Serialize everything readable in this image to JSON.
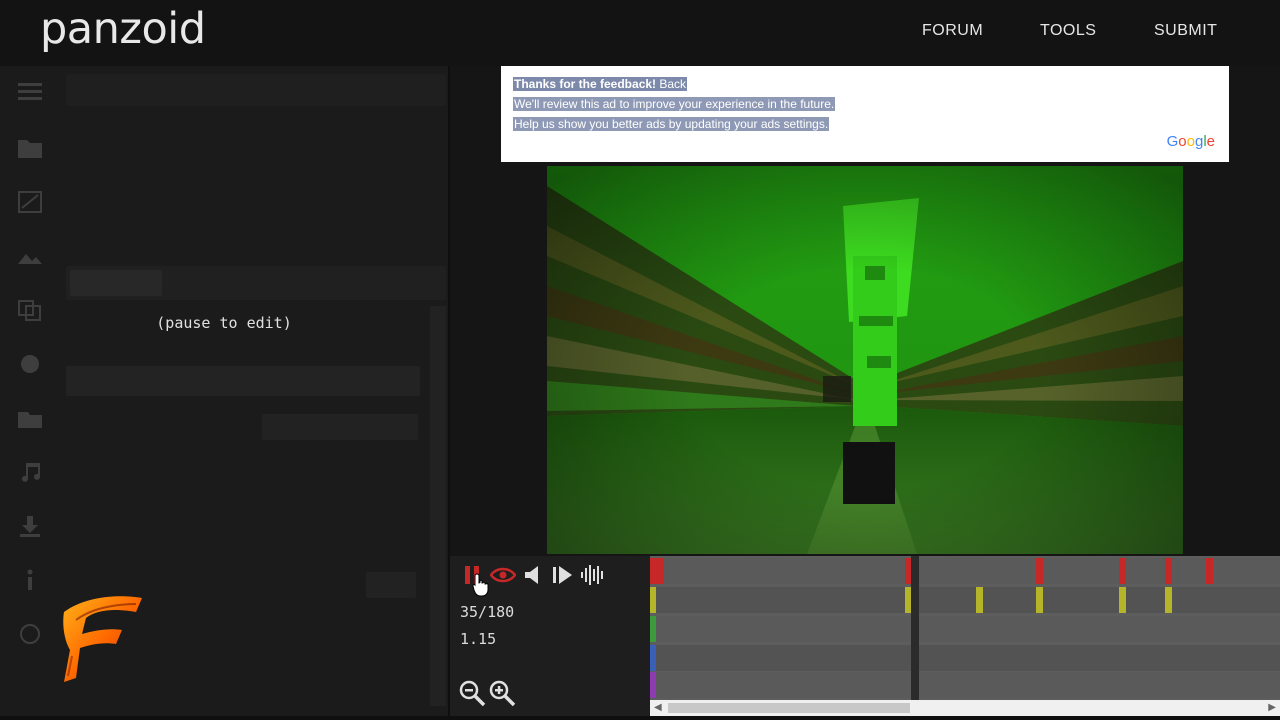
{
  "brand": {
    "logo_text": "panzoid"
  },
  "nav": {
    "items": [
      "FORUM",
      "TOOLS",
      "SUBMIT"
    ]
  },
  "editor": {
    "pause_message": "(pause to edit)",
    "rail_icons": [
      "menu-icon",
      "folder-icon",
      "crop-icon",
      "image-icon",
      "layers-icon",
      "shape-icon",
      "folder-2-icon",
      "music-icon",
      "download-icon",
      "info-icon",
      "circle-icon"
    ]
  },
  "ad": {
    "line1_bold": "Thanks for the feedback!",
    "line1_link": "Back",
    "line2": "We'll review this ad to improve your experience in the future.",
    "line3": "Help us show you better ads by updating your ads settings.",
    "google_label": "Google"
  },
  "playback": {
    "frame": "35/180",
    "time": "1.15",
    "progress": 0.194
  },
  "timeline": {
    "track_colors": [
      "#c62828",
      "#b5b52a",
      "#3c9b3c",
      "#3a5fb8",
      "#8e3ab0"
    ],
    "markers_row1": [
      0.0,
      0.405,
      0.613,
      0.745,
      0.817,
      0.883
    ],
    "markers_row2": [
      0.0,
      0.405,
      0.517,
      0.613,
      0.745,
      0.817
    ],
    "playhead": 0.414
  },
  "colors": {
    "accent_red": "#c62828",
    "screen_green": "#1e8c10"
  }
}
